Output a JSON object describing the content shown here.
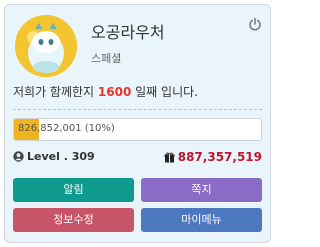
{
  "profile": {
    "nickname": "오공라우처",
    "rank": "스페셜"
  },
  "greeting": {
    "prefix": "저희가 함께한지 ",
    "days": "1600",
    "suffix": " 일째 입니다."
  },
  "exp": {
    "text": "826,852,001 (10%)",
    "percent": 10
  },
  "level": {
    "text": "Level . 309"
  },
  "points": {
    "text": "887,357,519"
  },
  "buttons": {
    "notify": "알림",
    "message": "쪽지",
    "edit_info": "정보수정",
    "my_menu": "마이메뉴"
  },
  "colors": {
    "points": "#c0162b",
    "days": "#e8342a",
    "exp_fill": "#f0b420",
    "notify": "#0f9a8e",
    "message": "#8a6cc6",
    "edit_info": "#c85567",
    "my_menu": "#4c78c0"
  },
  "icons": {
    "power": "power-icon",
    "user": "user-icon",
    "points": "gift-icon"
  }
}
